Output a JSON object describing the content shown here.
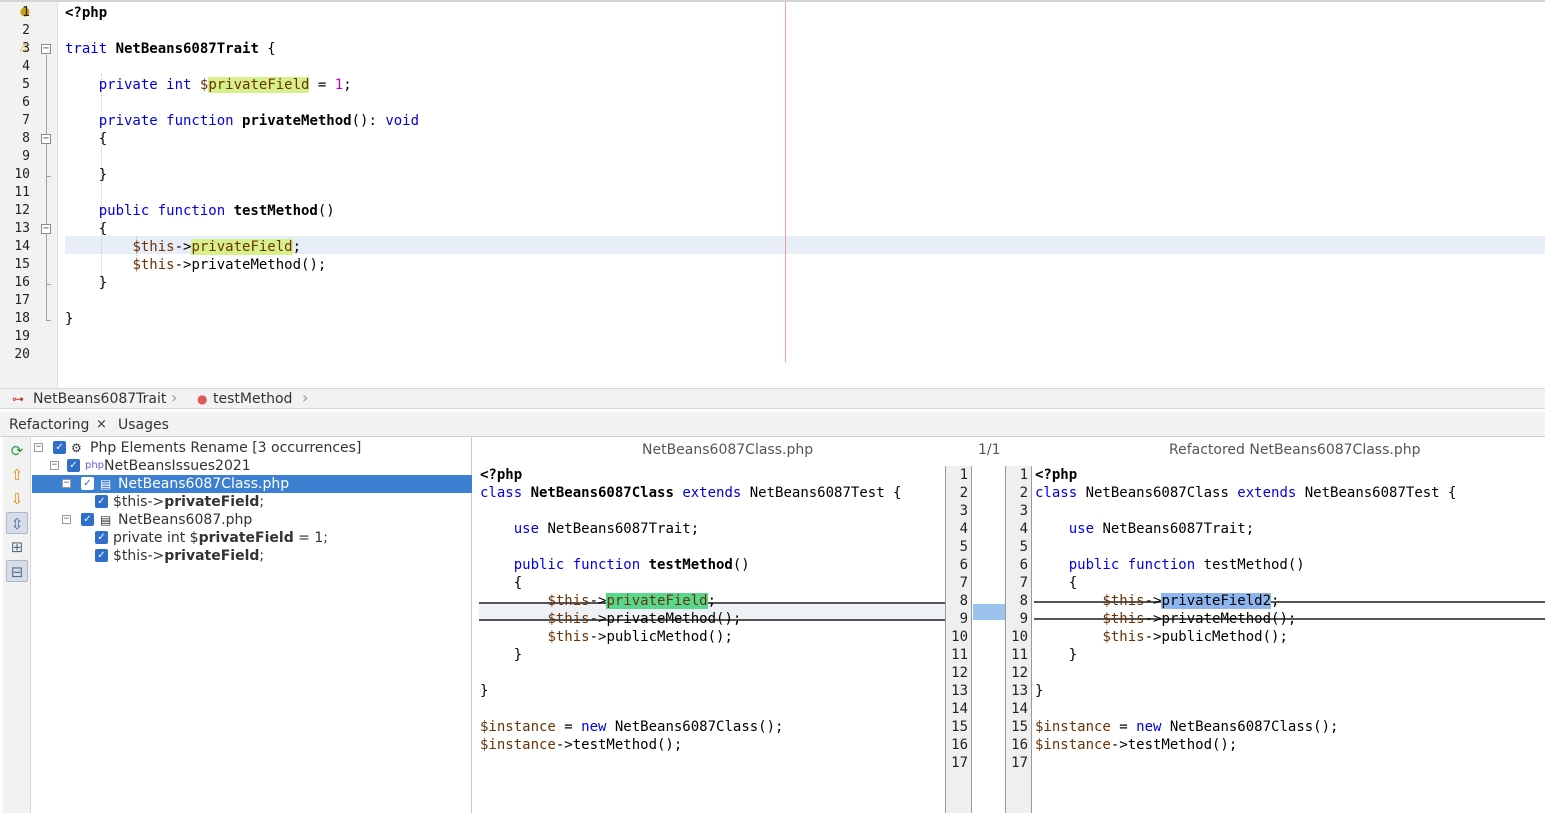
{
  "editor": {
    "lines": [
      {
        "n": "1",
        "t": [
          {
            "s": "<?php",
            "c": "b"
          }
        ]
      },
      {
        "n": "2",
        "t": []
      },
      {
        "n": "3",
        "t": [
          {
            "s": "trait ",
            "c": "kw"
          },
          {
            "s": "NetBeans6087Trait",
            "c": "b"
          },
          {
            "s": " {",
            "c": ""
          }
        ]
      },
      {
        "n": "4",
        "t": []
      },
      {
        "n": "5",
        "t": [
          {
            "s": "    ",
            "c": ""
          },
          {
            "s": "private int ",
            "c": "kw"
          },
          {
            "s": "$",
            "c": "var"
          },
          {
            "s": "privateField",
            "c": "var hl-y"
          },
          {
            "s": " = ",
            "c": ""
          },
          {
            "s": "1",
            "c": "num"
          },
          {
            "s": ";",
            "c": ""
          }
        ]
      },
      {
        "n": "6",
        "t": []
      },
      {
        "n": "7",
        "t": [
          {
            "s": "    ",
            "c": ""
          },
          {
            "s": "private function ",
            "c": "kw"
          },
          {
            "s": "privateMethod",
            "c": "b"
          },
          {
            "s": "(): ",
            "c": ""
          },
          {
            "s": "void",
            "c": "kw"
          }
        ]
      },
      {
        "n": "8",
        "t": [
          {
            "s": "    {",
            "c": ""
          }
        ]
      },
      {
        "n": "9",
        "t": []
      },
      {
        "n": "10",
        "t": [
          {
            "s": "    }",
            "c": ""
          }
        ]
      },
      {
        "n": "11",
        "t": []
      },
      {
        "n": "12",
        "t": [
          {
            "s": "    ",
            "c": ""
          },
          {
            "s": "public function ",
            "c": "kw"
          },
          {
            "s": "testMethod",
            "c": "b"
          },
          {
            "s": "()",
            "c": ""
          }
        ]
      },
      {
        "n": "13",
        "t": [
          {
            "s": "    {",
            "c": ""
          }
        ]
      },
      {
        "n": "14",
        "t": [
          {
            "s": "        ",
            "c": ""
          },
          {
            "s": "$this",
            "c": "var"
          },
          {
            "s": "->",
            "c": ""
          },
          {
            "s": "privateField",
            "c": "var hl-y"
          },
          {
            "s": ";",
            "c": ""
          }
        ]
      },
      {
        "n": "15",
        "t": [
          {
            "s": "        ",
            "c": ""
          },
          {
            "s": "$this",
            "c": "var"
          },
          {
            "s": "->privateMethod();",
            "c": ""
          }
        ]
      },
      {
        "n": "16",
        "t": [
          {
            "s": "    }",
            "c": ""
          }
        ]
      },
      {
        "n": "17",
        "t": []
      },
      {
        "n": "18",
        "t": [
          {
            "s": "}",
            "c": ""
          }
        ]
      },
      {
        "n": "19",
        "t": []
      },
      {
        "n": "20",
        "t": []
      }
    ]
  },
  "breadcrumbs": {
    "trait": "NetBeans6087Trait",
    "method": "testMethod"
  },
  "panel": {
    "tabs": {
      "refactoring": "Refactoring",
      "close": "×",
      "usages": "Usages"
    },
    "tree": {
      "root": "Php Elements Rename [3 occurrences]",
      "project": "NetBeansIssues2021",
      "file1": "NetBeans6087Class.php",
      "file1_u1_pre": "$this->",
      "file1_u1_bold": "privateField",
      "file1_u1_post": ";",
      "file2": "NetBeans6087.php",
      "file2_u1_pre": "private int $",
      "file2_u1_bold": "privateField",
      "file2_u1_post": " = 1;",
      "file2_u2_pre": "$this->",
      "file2_u2_bold": "privateField",
      "file2_u2_post": ";"
    },
    "diff": {
      "left_title": "NetBeans6087Class.php",
      "counter": "1/1",
      "right_title": "Refactored NetBeans6087Class.php",
      "line_numbers": [
        "1",
        "2",
        "3",
        "4",
        "5",
        "6",
        "7",
        "8",
        "9",
        "10",
        "11",
        "12",
        "13",
        "14",
        "15",
        "16",
        "17"
      ],
      "left": [
        [
          {
            "s": "<?php",
            "c": "b"
          }
        ],
        [
          {
            "s": "class ",
            "c": "kw"
          },
          {
            "s": "NetBeans6087Class",
            "c": "b"
          },
          {
            "s": " ",
            "c": ""
          },
          {
            "s": "extends",
            "c": "kw"
          },
          {
            "s": " NetBeans6087Test {",
            "c": ""
          }
        ],
        [],
        [
          {
            "s": "    ",
            "c": ""
          },
          {
            "s": "use",
            "c": "kw"
          },
          {
            "s": " NetBeans6087Trait;",
            "c": ""
          }
        ],
        [],
        [
          {
            "s": "    ",
            "c": ""
          },
          {
            "s": "public function ",
            "c": "kw"
          },
          {
            "s": "testMethod",
            "c": "b"
          },
          {
            "s": "()",
            "c": ""
          }
        ],
        [
          {
            "s": "    {",
            "c": ""
          }
        ],
        [
          {
            "s": "        ",
            "c": ""
          },
          {
            "s": "$this",
            "c": "var"
          },
          {
            "s": "->",
            "c": ""
          },
          {
            "s": "privateField",
            "c": "var hl-g"
          },
          {
            "s": ";",
            "c": ""
          }
        ],
        [
          {
            "s": "        ",
            "c": ""
          },
          {
            "s": "$this",
            "c": "var"
          },
          {
            "s": "->privateMethod();",
            "c": ""
          }
        ],
        [
          {
            "s": "        ",
            "c": ""
          },
          {
            "s": "$this",
            "c": "var"
          },
          {
            "s": "->publicMethod();",
            "c": ""
          }
        ],
        [
          {
            "s": "    }",
            "c": ""
          }
        ],
        [],
        [
          {
            "s": "}",
            "c": ""
          }
        ],
        [],
        [
          {
            "s": "$instance",
            "c": "var"
          },
          {
            "s": " = ",
            "c": ""
          },
          {
            "s": "new",
            "c": "kw"
          },
          {
            "s": " NetBeans6087Class();",
            "c": ""
          }
        ],
        [
          {
            "s": "$instance",
            "c": "var"
          },
          {
            "s": "->testMethod();",
            "c": ""
          }
        ],
        []
      ],
      "right": [
        [
          {
            "s": "<?php",
            "c": "b"
          }
        ],
        [
          {
            "s": "class ",
            "c": "kw"
          },
          {
            "s": "NetBeans6087Class ",
            "c": ""
          },
          {
            "s": "extends",
            "c": "kw"
          },
          {
            "s": " NetBeans6087Test {",
            "c": ""
          }
        ],
        [],
        [
          {
            "s": "    ",
            "c": ""
          },
          {
            "s": "use",
            "c": "kw"
          },
          {
            "s": " NetBeans6087Trait;",
            "c": ""
          }
        ],
        [],
        [
          {
            "s": "    ",
            "c": ""
          },
          {
            "s": "public function ",
            "c": "kw"
          },
          {
            "s": "testMethod()",
            "c": ""
          }
        ],
        [
          {
            "s": "    {",
            "c": ""
          }
        ],
        [
          {
            "s": "        ",
            "c": ""
          },
          {
            "s": "$this",
            "c": "var"
          },
          {
            "s": "->",
            "c": ""
          },
          {
            "s": "privateField2",
            "c": "hl-b"
          },
          {
            "s": ";",
            "c": ""
          }
        ],
        [
          {
            "s": "        ",
            "c": ""
          },
          {
            "s": "$this",
            "c": "var"
          },
          {
            "s": "->privateMethod();",
            "c": ""
          }
        ],
        [
          {
            "s": "        ",
            "c": ""
          },
          {
            "s": "$this",
            "c": "var"
          },
          {
            "s": "->publicMethod();",
            "c": ""
          }
        ],
        [
          {
            "s": "    }",
            "c": ""
          }
        ],
        [],
        [
          {
            "s": "}",
            "c": ""
          }
        ],
        [],
        [
          {
            "s": "$instance",
            "c": "var"
          },
          {
            "s": " = ",
            "c": ""
          },
          {
            "s": "new",
            "c": "kw"
          },
          {
            "s": " NetBeans6087Class();",
            "c": ""
          }
        ],
        [
          {
            "s": "$instance",
            "c": "var"
          },
          {
            "s": "->testMethod();",
            "c": ""
          }
        ],
        []
      ]
    }
  },
  "icons": {
    "hint": "lightbulb-icon",
    "warning": "warning-icon",
    "trait": "trait-icon",
    "method": "method-icon",
    "refresh": "refresh-icon",
    "prev": "arrow-up-icon",
    "next": "arrow-down-icon"
  },
  "colors": {
    "keyword": "#0000e6",
    "variable": "#6d3206",
    "highlight": "#d6f08a",
    "selection": "#3d7fd0"
  }
}
